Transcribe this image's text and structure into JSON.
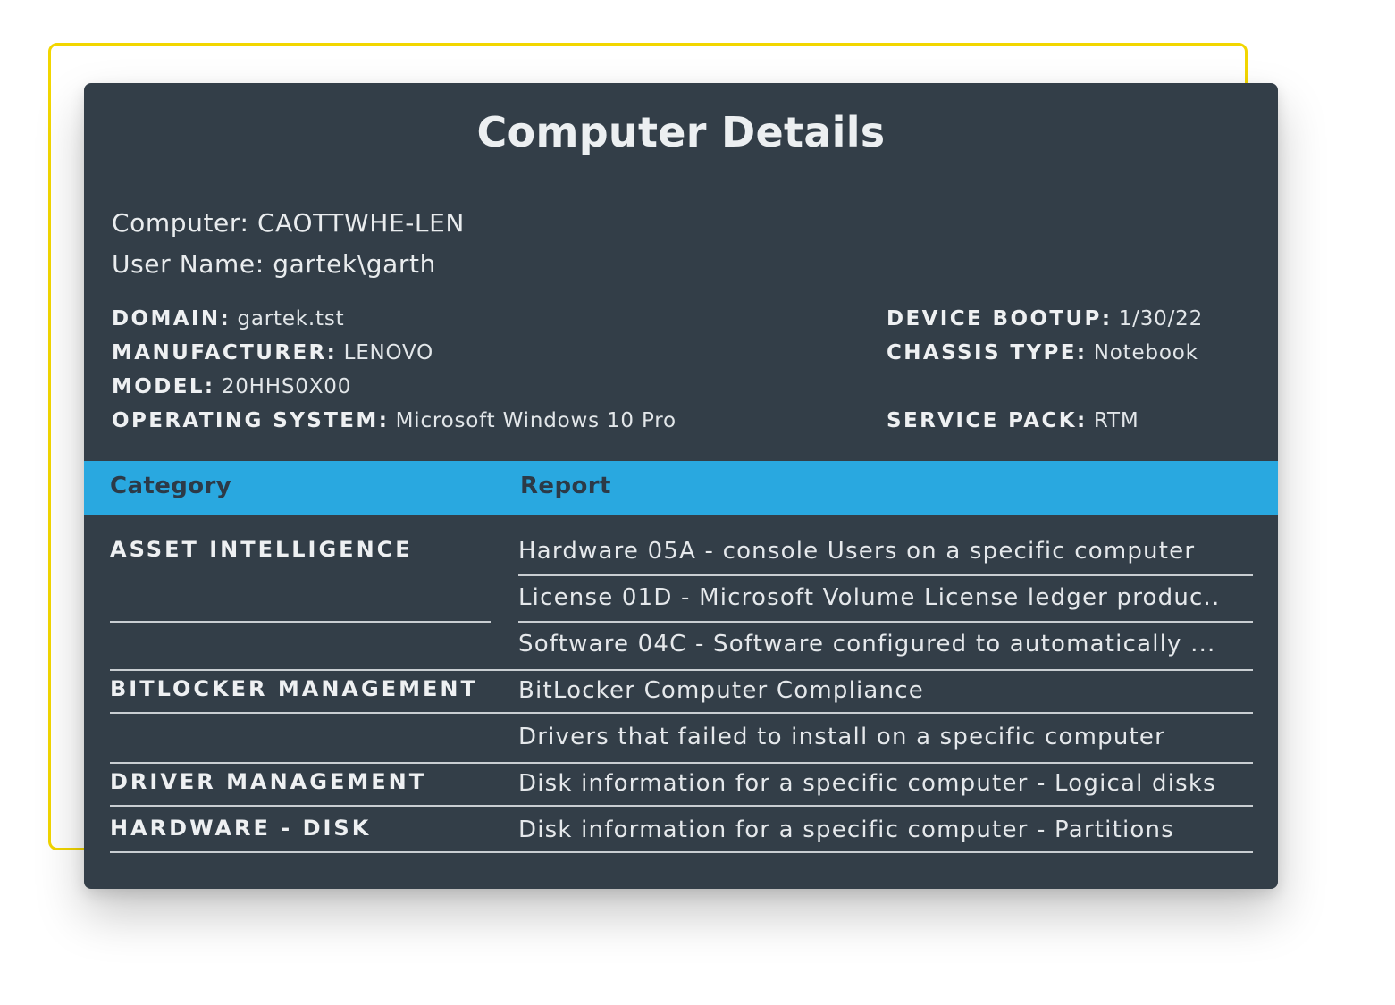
{
  "title": "Computer Details",
  "computer": "Computer: CAOTTWHE-LEN",
  "user_name": "User Name: gartek\\garth",
  "properties": {
    "domain": {
      "label": "DOMAIN:",
      "value": "gartek.tst"
    },
    "manufacturer": {
      "label": "MANUFACTURER:",
      "value": "LENOVO"
    },
    "model": {
      "label": "MODEL:",
      "value": "20HHS0X00"
    },
    "operating_system": {
      "label": "OPERATING SYSTEM:",
      "value": "Microsoft Windows 10 Pro"
    },
    "device_bootup": {
      "label": "DEVICE BOOTUP:",
      "value": "1/30/22"
    },
    "chassis_type": {
      "label": "CHASSIS TYPE:",
      "value": "Notebook"
    },
    "service_pack": {
      "label": "SERVICE PACK:",
      "value": "RTM"
    }
  },
  "table": {
    "headers": [
      "Category",
      "Report"
    ],
    "categories": [
      "ASSET INTELLIGENCE",
      "BITLOCKER MANAGEMENT",
      "DRIVER MANAGEMENT",
      "HARDWARE - DISK"
    ],
    "reports": [
      "Hardware 05A - console Users on a specific computer",
      "License 01D - Microsoft Volume License ledger produc..",
      "Software 04C - Software configured to automatically ...",
      "BitLocker Computer Compliance",
      "Drivers that failed to install on a specific computer",
      "Disk information for a specific computer - Logical disks",
      "Disk information for a specific computer - Partitions"
    ]
  },
  "colors": {
    "panel_bg": "#333e48",
    "header_accent": "#29a8e0",
    "frame_accent": "#f2d600"
  }
}
